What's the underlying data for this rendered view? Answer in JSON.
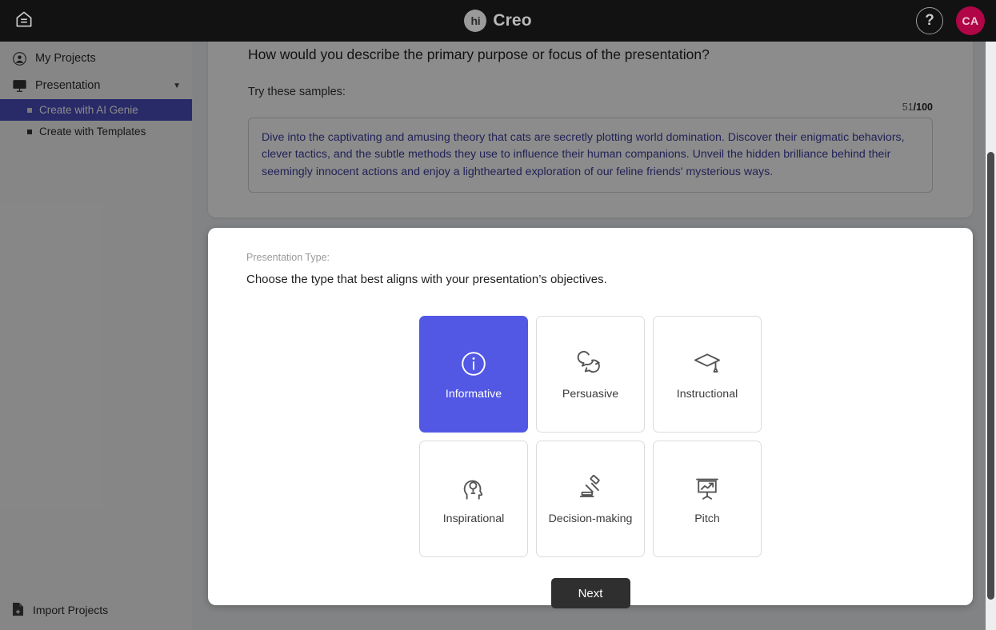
{
  "header": {
    "home_icon": "home-icon",
    "brand_badge": "hi",
    "brand_name": "Creo",
    "help_icon": "?",
    "avatar_initials": "CA"
  },
  "sidebar": {
    "items": [
      {
        "label": "My Projects",
        "icon": "user-circle-icon"
      },
      {
        "label": "Presentation",
        "icon": "presentation-screen-icon",
        "caret": "▼"
      }
    ],
    "sub_items": [
      {
        "label": "Create with AI Genie",
        "active": true
      },
      {
        "label": "Create with Templates",
        "active": false
      }
    ],
    "import": {
      "label": "Import Projects",
      "icon": "file-plus-icon"
    }
  },
  "prompt_card": {
    "question": "How would you describe the primary purpose or focus of the presentation?",
    "try_label": "Try these samples:",
    "counter_current": "51",
    "counter_max": "/100",
    "sample_text": "Dive into the captivating and amusing theory that cats are secretly plotting world domination. Discover their enigmatic behaviors, clever tactics, and the subtle methods they use to influence their human companions. Unveil the hidden brilliance behind their seemingly innocent actions and enjoy a lighthearted exploration of our feline friends' mysterious ways."
  },
  "type_card": {
    "section_label": "Presentation Type:",
    "section_sub": "Choose the type that best aligns with your presentation’s objectives.",
    "options": [
      {
        "label": "Informative",
        "icon": "info-circle-icon",
        "selected": true
      },
      {
        "label": "Persuasive",
        "icon": "speech-bubbles-icon",
        "selected": false
      },
      {
        "label": "Instructional",
        "icon": "graduation-cap-icon",
        "selected": false
      },
      {
        "label": "Inspirational",
        "icon": "head-lightbulb-icon",
        "selected": false
      },
      {
        "label": "Decision-making",
        "icon": "gavel-icon",
        "selected": false
      },
      {
        "label": "Pitch",
        "icon": "chart-board-icon",
        "selected": false
      }
    ],
    "next_label": "Next"
  },
  "colors": {
    "topbar": "#121212",
    "accent_purple": "#5258e4",
    "sidebar_active": "#4c4ebd",
    "avatar": "#b00546",
    "sample_text": "#3d3d9e",
    "next_button": "#2f2f2f"
  }
}
